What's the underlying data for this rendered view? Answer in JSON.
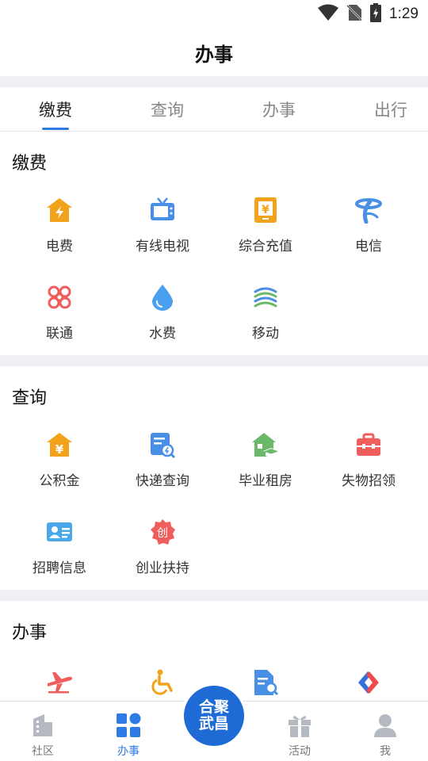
{
  "status": {
    "time": "1:29"
  },
  "header": {
    "title": "办事"
  },
  "tabs": [
    {
      "label": "缴费",
      "active": true
    },
    {
      "label": "查询",
      "active": false
    },
    {
      "label": "办事",
      "active": false
    },
    {
      "label": "出行",
      "active": false
    }
  ],
  "sections": {
    "payment": {
      "title": "缴费",
      "items": [
        {
          "label": "电费",
          "icon": "electricity-icon"
        },
        {
          "label": "有线电视",
          "icon": "tv-icon"
        },
        {
          "label": "综合充值",
          "icon": "recharge-icon"
        },
        {
          "label": "电信",
          "icon": "telecom-icon"
        },
        {
          "label": "联通",
          "icon": "unicom-icon"
        },
        {
          "label": "水费",
          "icon": "water-drop-icon"
        },
        {
          "label": "移动",
          "icon": "mobile-icon"
        }
      ]
    },
    "query": {
      "title": "查询",
      "items": [
        {
          "label": "公积金",
          "icon": "housing-fund-icon"
        },
        {
          "label": "快递查询",
          "icon": "express-search-icon"
        },
        {
          "label": "毕业租房",
          "icon": "graduate-house-icon"
        },
        {
          "label": "失物招领",
          "icon": "toolbox-icon"
        },
        {
          "label": "招聘信息",
          "icon": "id-card-icon"
        },
        {
          "label": "创业扶持",
          "icon": "startup-badge-icon"
        }
      ]
    },
    "affairs": {
      "title": "办事",
      "items": [
        {
          "label": "",
          "icon": "airplane-icon"
        },
        {
          "label": "",
          "icon": "wheelchair-icon"
        },
        {
          "label": "",
          "icon": "document-search-icon"
        },
        {
          "label": "",
          "icon": "railway-icon"
        }
      ]
    }
  },
  "bottom_nav": {
    "items": [
      {
        "label": "社区",
        "icon": "community-icon",
        "active": false
      },
      {
        "label": "办事",
        "icon": "services-grid-icon",
        "active": true
      },
      {
        "label": "活动",
        "icon": "gift-icon",
        "active": false
      },
      {
        "label": "我",
        "icon": "user-icon",
        "active": false
      }
    ],
    "center_badge": {
      "line1": "合聚",
      "line2": "武昌"
    }
  },
  "colors": {
    "accent": "#2d7be5",
    "orange": "#f2a31b",
    "blue": "#4a8fe6",
    "red": "#ef5d5d",
    "green": "#6cb86a"
  }
}
